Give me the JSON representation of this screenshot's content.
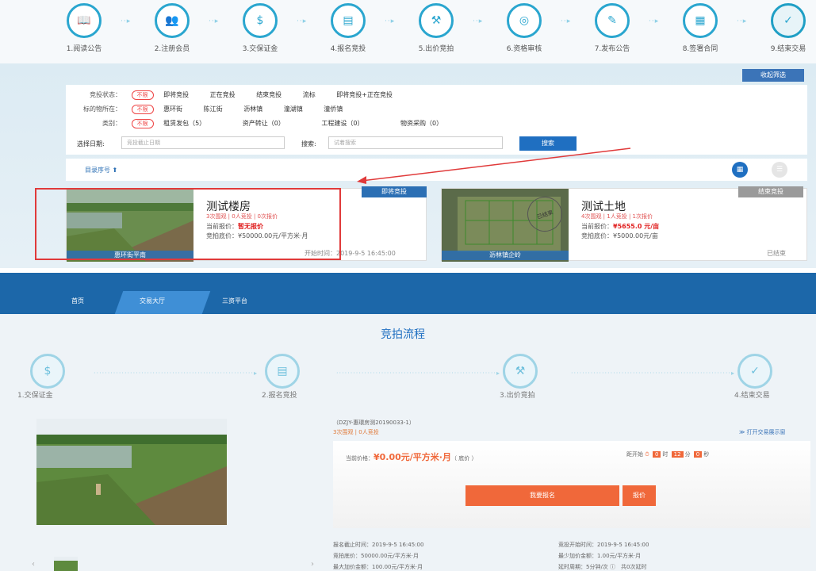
{
  "steps": [
    {
      "label": "1.阅读公告",
      "icon": "book-icon"
    },
    {
      "label": "2.注册会员",
      "icon": "users-icon"
    },
    {
      "label": "3.交保证金",
      "icon": "money-bag-icon"
    },
    {
      "label": "4.报名竞投",
      "icon": "form-icon"
    },
    {
      "label": "5.出价竞拍",
      "icon": "gavel-icon"
    },
    {
      "label": "6.资格审核",
      "icon": "review-icon"
    },
    {
      "label": "7.发布公告",
      "icon": "edit-icon"
    },
    {
      "label": "8.签署合同",
      "icon": "contract-icon"
    },
    {
      "label": "9.结束交易",
      "icon": "check-icon"
    }
  ],
  "filter": {
    "collapse": "收起筛选",
    "status_label": "竞投状态：",
    "status_all": "不限",
    "status_opts": [
      "即将竞投",
      "正在竞投",
      "结束竞投",
      "流标",
      "即将竞投+正在竞投"
    ],
    "loc_label": "标的物所在：",
    "loc_all": "不限",
    "loc_opts": [
      "惠环街",
      "陈江街",
      "沥林镇",
      "潼湖镇",
      "潼侨镇"
    ],
    "type_label": "类别：",
    "type_all": "不限",
    "type_opts": [
      "租赁发包（5）",
      "资产转让（0）",
      "工程建设（0）",
      "物资采购（0）"
    ],
    "date_label": "选择日期:",
    "date_ph": "竞投截止日期",
    "search_label": "搜索:",
    "search_ph": "试着搜索",
    "search_btn": "搜索"
  },
  "sort": {
    "label": "目录序号 ⬆"
  },
  "cards": [
    {
      "badge": "即将竞投",
      "badge_color": "#2b6fb4",
      "title": "测试楼房",
      "stats": "3次围观 | 0人竞投 | 0次报价",
      "price_label": "当前报价：",
      "price": "暂无报价",
      "base": "竞拍底价：¥50000.00元/平方米·月",
      "foot": "开始时间：2019-9-5 16:45:00",
      "caption": "惠环街平南"
    },
    {
      "badge": "结束竞投",
      "badge_color": "#9a9a9a",
      "title": "测试土地",
      "stats": "4次围观 | 1人竞投 | 1次报价",
      "price_label": "当前报价：",
      "price": "¥5655.0 元/亩",
      "base": "竞拍底价：¥5000.00元/亩",
      "foot": "已结束",
      "caption": "沥林镇企岭",
      "stamp": "已结束"
    }
  ],
  "nav": [
    "首页",
    "交易大厅",
    "三资平台"
  ],
  "flow": {
    "title": "竞拍流程",
    "steps": [
      "1.交保证金",
      "2.报名竞投",
      "3.出价竞拍",
      "4.结束交易"
    ]
  },
  "detail": {
    "code": "（DZJY-惠環房测20190033-1）",
    "stats": "3次围观 | 0人竞投",
    "open_link": "≫ 打开交易展示窗",
    "cur_price_label": "当前价格：",
    "cur_price": "¥0.00元/平方米·月",
    "cur_price_note": "（ 底价 ）",
    "countdown_label": "距开始",
    "cd": [
      "0",
      "12",
      "0"
    ],
    "cd_units": [
      "时",
      "分",
      "秒"
    ],
    "bid_btn": "我要报名",
    "bid_btn2": "报价",
    "reg_end": "报名截止时间：2019-9-5 16:45:00",
    "start": "竞投开始时间：2019-9-5 16:45:00",
    "base": "竞拍底价：50000.00元/平方米·月",
    "min_inc": "最少加价金额：1.00元/平方米·月",
    "max_inc": "最大加价金额：100.00元/平方米·月",
    "delay": "延时周期：5分钟/次 ⓘ　共0次延时"
  }
}
